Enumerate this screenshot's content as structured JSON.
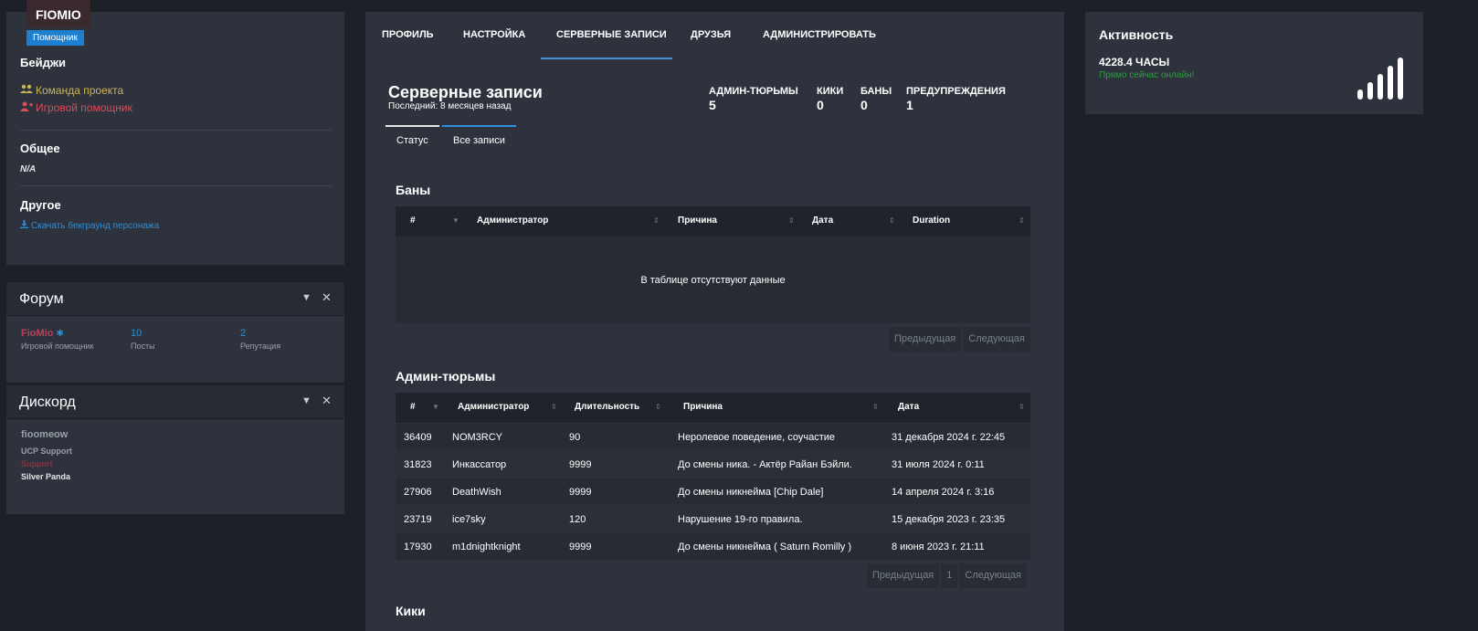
{
  "profile": {
    "username": "FIOMIO",
    "role_badge": "Помощник",
    "badges_title": "Бейджи",
    "badges": [
      {
        "label": "Команда проекта",
        "icon": "users-icon",
        "color": "#c9b458"
      },
      {
        "label": "Игровой помощник",
        "icon": "user-plus-icon",
        "color": "#d94c5a"
      }
    ],
    "general_title": "Общее",
    "general_value": "N/A",
    "other_title": "Другое",
    "download_link": "Скачать бекграунд персонажа"
  },
  "forum": {
    "title": "Форум",
    "user": "FioMio",
    "user_role": "Игровой помощник",
    "posts_value": "10",
    "posts_label": "Посты",
    "reputation_value": "2",
    "reputation_label": "Репутация"
  },
  "discord": {
    "title": "Дискорд",
    "user": "fioomeow",
    "roles": [
      {
        "label": "UCP Support",
        "color": "#9aa0a8"
      },
      {
        "label": "Support",
        "color": "#8a3040"
      },
      {
        "label": "Silver Panda",
        "color": "#e6e6e6"
      }
    ]
  },
  "nav": {
    "tabs": [
      "ПРОФИЛЬ",
      "НАСТРОЙКА",
      "СЕРВЕРНЫЕ ЗАПИСИ",
      "ДРУЗЬЯ",
      "АДМИНИСТРИРОВАТЬ"
    ],
    "active": "СЕРВЕРНЫЕ ЗАПИСИ"
  },
  "records": {
    "title": "Серверные записи",
    "subtitle": "Последний: 8 месяцев назад",
    "stats": [
      {
        "label": "АДМИН-ТЮРЬМЫ",
        "value": "5"
      },
      {
        "label": "КИКИ",
        "value": "0"
      },
      {
        "label": "БАНЫ",
        "value": "0"
      },
      {
        "label": "ПРЕДУПРЕЖДЕНИЯ",
        "value": "1"
      }
    ],
    "subtabs": [
      "Статус",
      "Все записи"
    ]
  },
  "bans": {
    "title": "Баны",
    "columns": [
      "#",
      "Администратор",
      "Причина",
      "Дата",
      "Duration"
    ],
    "empty_text": "В таблице отсутствуют данные",
    "prev": "Предыдущая",
    "next": "Следующая"
  },
  "jails": {
    "title": "Админ-тюрьмы",
    "columns": [
      "#",
      "Администратор",
      "Длительность",
      "Причина",
      "Дата"
    ],
    "rows": [
      [
        "36409",
        "NOM3RCY",
        "90",
        "Неролевое поведение, соучастие",
        "31 декабря 2024 г. 22:45"
      ],
      [
        "31823",
        "Инкассатор",
        "9999",
        "До смены ника. - Актёр Райан Бэйли.",
        "31 июля 2024 г. 0:11"
      ],
      [
        "27906",
        "DeathWish",
        "9999",
        "До смены никнейма [Chip Dale]",
        "14 апреля 2024 г. 3:16"
      ],
      [
        "23719",
        "ice7sky",
        "120",
        "Нарушение 19-го правила.",
        "15 декабря 2023 г. 23:35"
      ],
      [
        "17930",
        "m1dnightknight",
        "9999",
        "До смены никнейма ( Saturn Romilly )",
        "8 июня 2023 г. 21:11"
      ]
    ],
    "prev": "Предыдущая",
    "page": "1",
    "next": "Следующая"
  },
  "kicks": {
    "title": "Кики"
  },
  "activity": {
    "title": "Активность",
    "hours": "4228.4 ЧАСЫ",
    "status": "Прямо сейчас онлайн!",
    "status_color": "#2e9e3e"
  }
}
